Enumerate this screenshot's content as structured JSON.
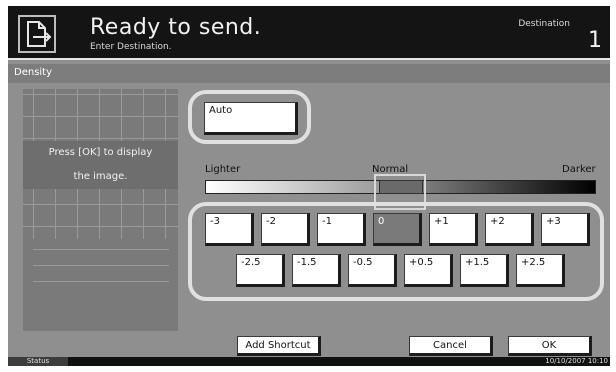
{
  "header": {
    "title": "Ready to send.",
    "subtitle": "Enter Destination.",
    "destination_label": "Destination",
    "destination_count": "1",
    "icon": "send-document-icon"
  },
  "tab": {
    "label": "Density"
  },
  "preview": {
    "line1": "Press [OK] to display",
    "line2": "the image."
  },
  "auto_button": {
    "label": "Auto",
    "selected": false
  },
  "scale": {
    "lighter": "Lighter",
    "normal": "Normal",
    "darker": "Darker"
  },
  "density_steps": {
    "row1": [
      "-3",
      "-2",
      "-1",
      "0",
      "+1",
      "+2",
      "+3"
    ],
    "row2": [
      "-2.5",
      "-1.5",
      "-0.5",
      "+0.5",
      "+1.5",
      "+2.5"
    ],
    "selected": "0"
  },
  "footer": {
    "add_shortcut": "Add Shortcut",
    "cancel": "Cancel",
    "ok": "OK"
  },
  "status_bar": {
    "status_label": "Status",
    "datetime": "10/10/2007   10:10"
  }
}
